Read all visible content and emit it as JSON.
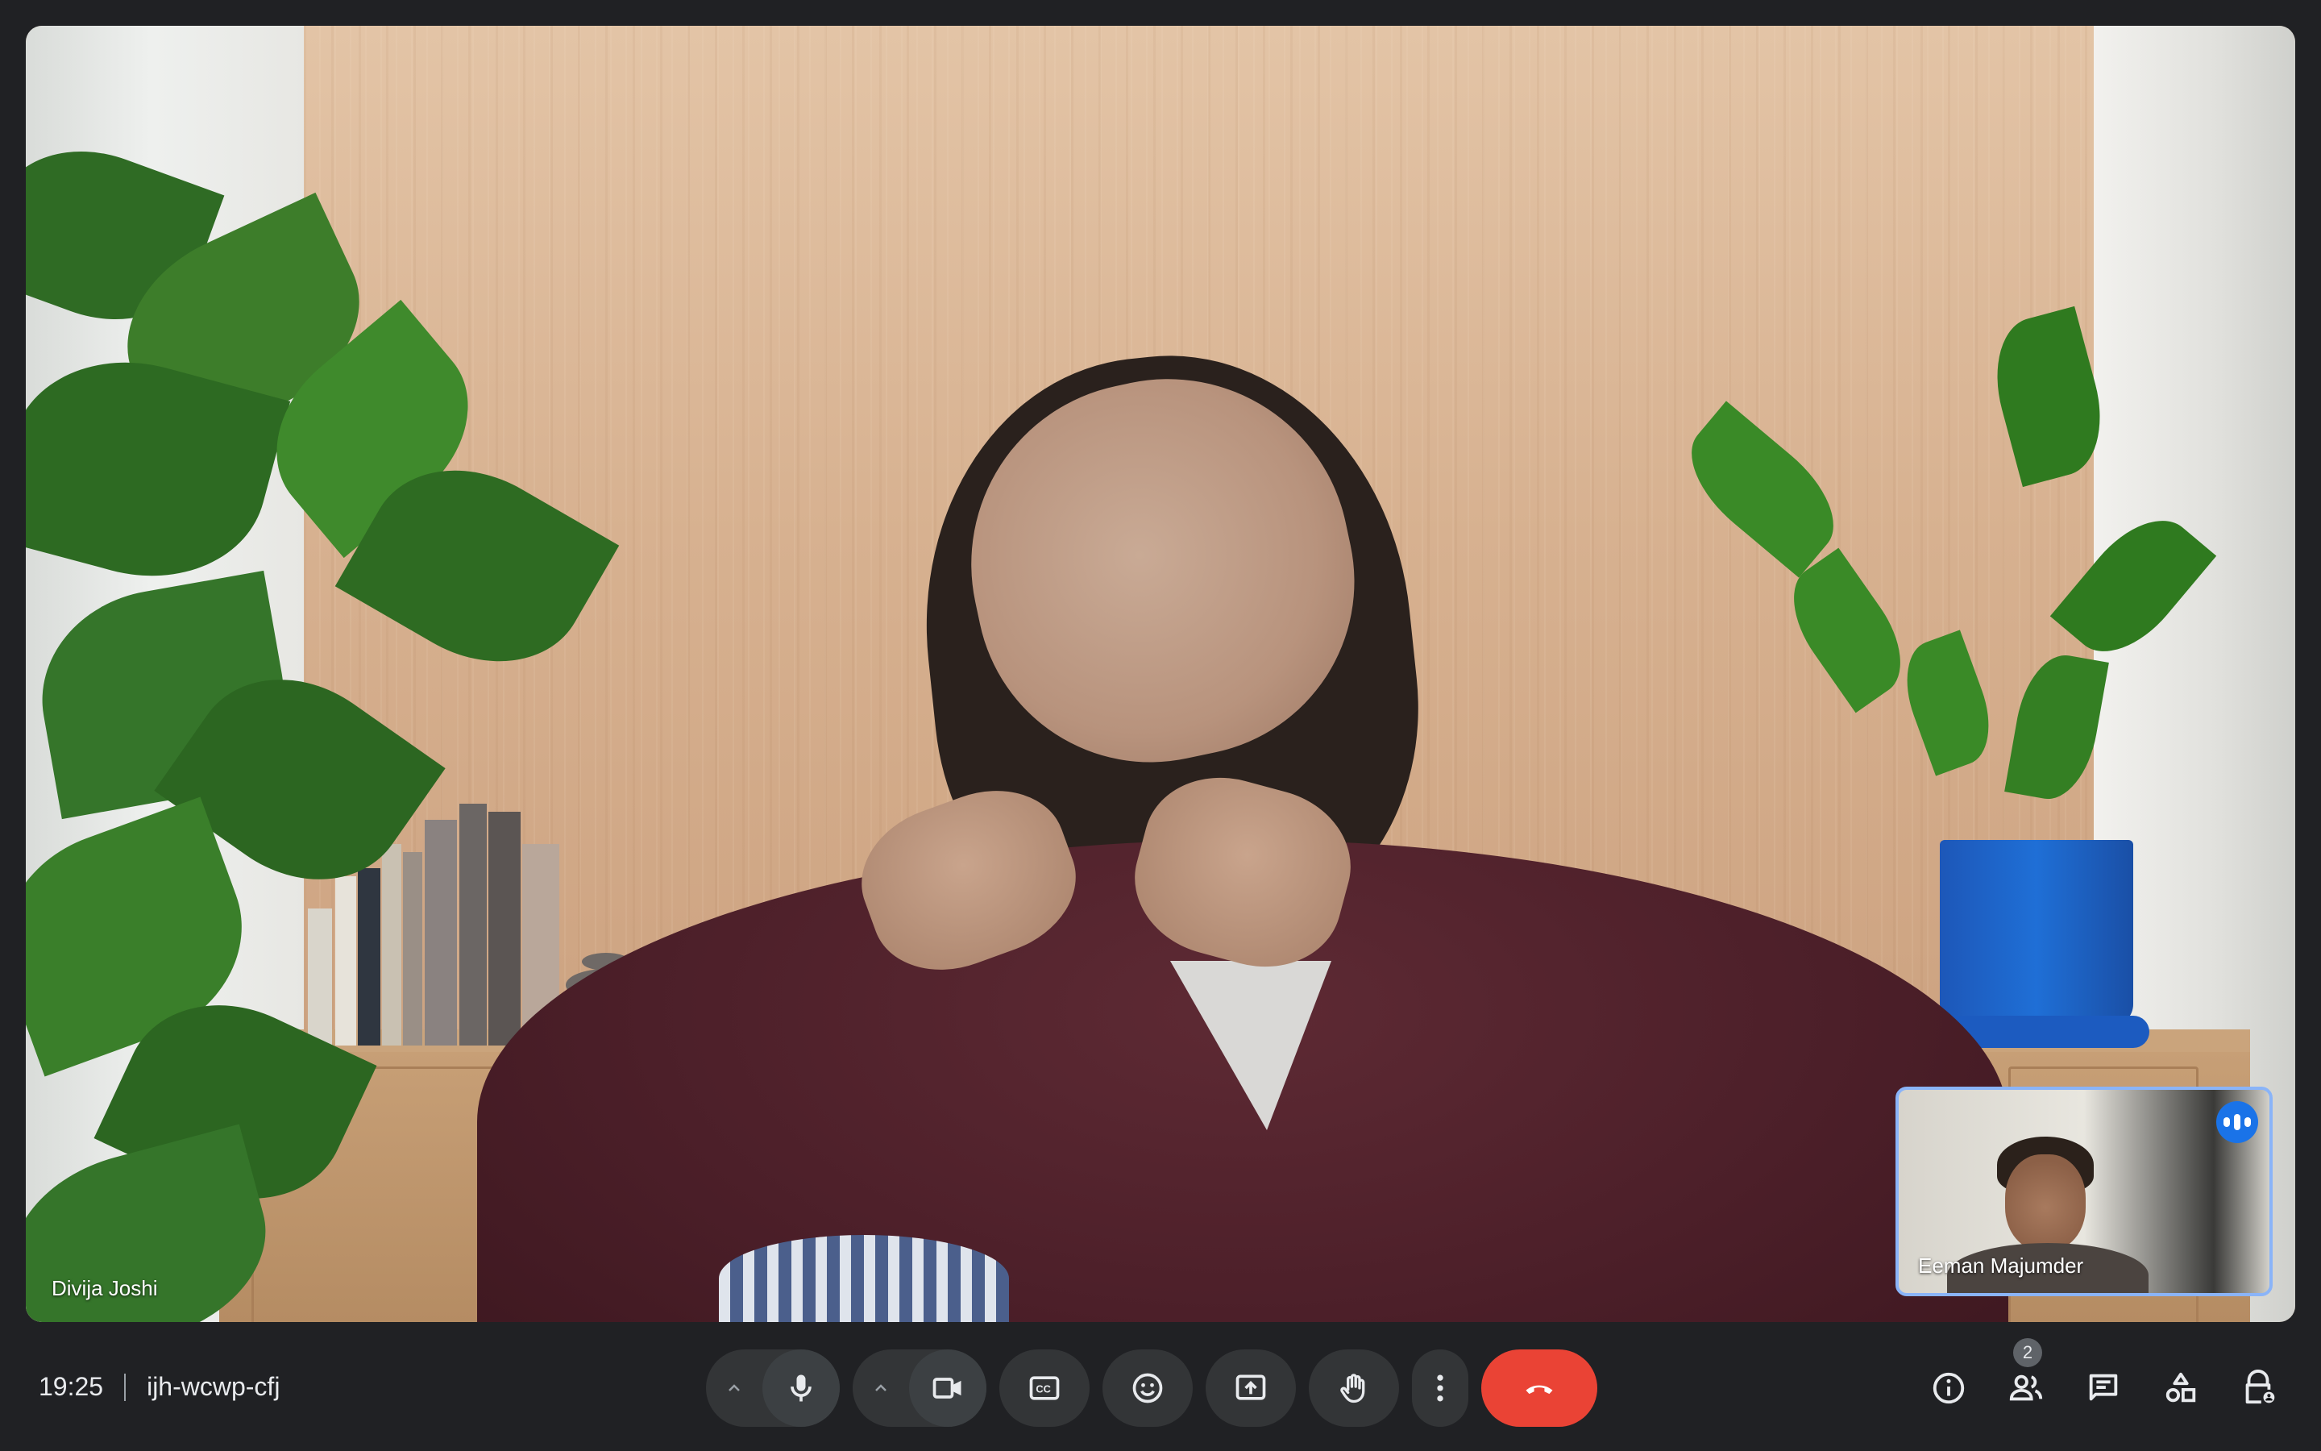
{
  "meeting": {
    "time": "19:25",
    "code": "ijh-wcwp-cfj"
  },
  "main_tile": {
    "participant_name": "Divija Joshi"
  },
  "self_view": {
    "participant_name": "Eeman Majumder",
    "speaking": true
  },
  "controls": {
    "mic_options_icon": "chevron-up-icon",
    "mic_icon": "microphone-icon",
    "camera_options_icon": "chevron-up-icon",
    "camera_icon": "videocam-icon",
    "captions_icon": "closed-captions-icon",
    "reactions_icon": "emoji-icon",
    "present_icon": "present-screen-icon",
    "raise_hand_icon": "raise-hand-icon",
    "more_icon": "more-vertical-icon",
    "leave_icon": "call-end-icon"
  },
  "side_panel_buttons": {
    "info_icon": "info-icon",
    "people_icon": "people-icon",
    "people_count": "2",
    "chat_icon": "chat-icon",
    "activities_icon": "activities-icon",
    "host_controls_icon": "lock-person-icon"
  },
  "colors": {
    "background": "#202124",
    "leave_button": "#ea4335",
    "self_view_border": "#8ab4f8",
    "speaking_badge": "#1a73e8"
  }
}
